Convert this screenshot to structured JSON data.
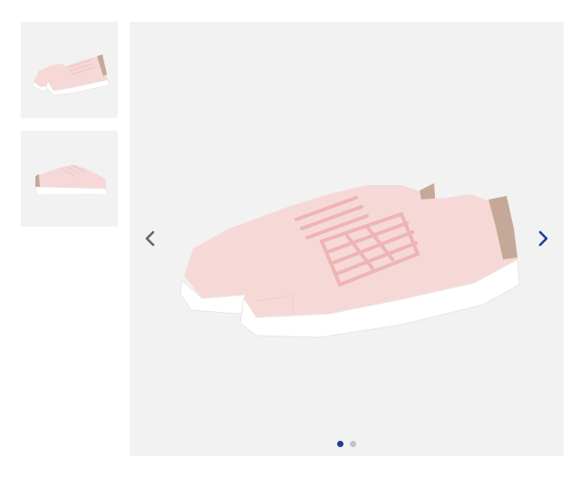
{
  "gallery": {
    "thumbnails": [
      {
        "icon": "sneaker-pair-angled-image",
        "selected": true
      },
      {
        "icon": "sneaker-side-view-image",
        "selected": false
      }
    ],
    "main_image": {
      "icon": "pink-sneaker-pair-image"
    },
    "prev_icon": "chevron-left-icon",
    "next_icon": "chevron-right-icon",
    "pagination": {
      "count": 2,
      "active_index": 0
    }
  },
  "colors": {
    "panel_background": "#f2f2f2",
    "shoe_upper": "#f6d9d7",
    "shoe_sole": "#ffffff",
    "heel_tab": "#c6a898",
    "prev_arrow": "#5f6670",
    "next_arrow": "#1c3f94",
    "dot_active": "#1c3f94",
    "dot_inactive": "#c4c4c4"
  }
}
